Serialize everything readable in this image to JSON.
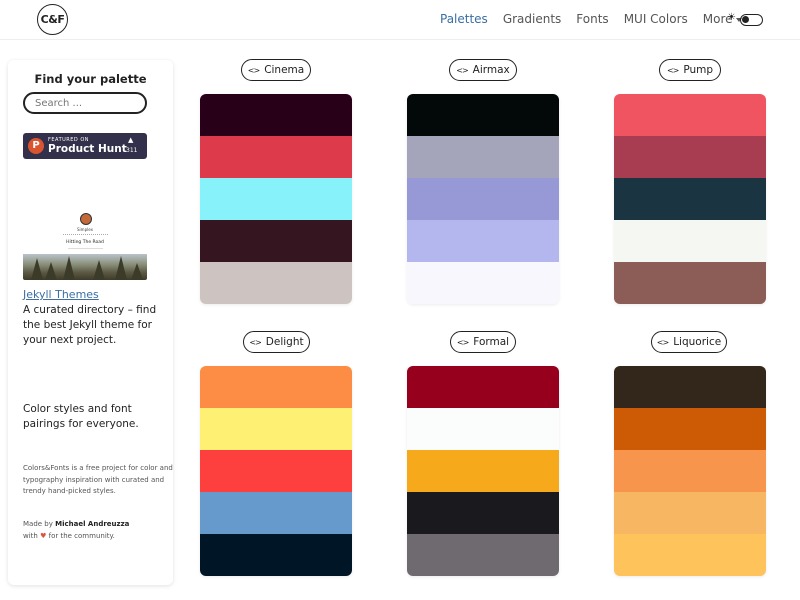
{
  "header": {
    "logo": "C&F",
    "nav": [
      {
        "label": "Palettes",
        "active": true
      },
      {
        "label": "Gradients",
        "active": false
      },
      {
        "label": "Fonts",
        "active": false
      },
      {
        "label": "MUI Colors",
        "active": false
      },
      {
        "label": "More",
        "active": false
      }
    ],
    "theme_icon": "sun-icon"
  },
  "sidebar": {
    "title": "Find your palette",
    "search_placeholder": "Search ...",
    "product_hunt": {
      "small": "FEATURED ON",
      "big": "Product Hunt",
      "count": "311"
    },
    "thumb": {
      "site_name": "Simplex",
      "post_title": "Hitting The Road"
    },
    "jekyll_link": "Jekyll Themes",
    "jekyll_desc": "A curated directory – find the best Jekyll theme for your next project.",
    "tagline": "Color styles and font pairings for everyone.",
    "about": "Colors&Fonts is a free project for color and typography inspiration with curated and trendy hand-picked styles.",
    "made_prefix": "Made by",
    "made_author": "Michael Andreuzza",
    "made_with": "with",
    "made_suffix": "for the community."
  },
  "palettes": [
    {
      "name": "Cinema",
      "colors": [
        "#280119",
        "#dd3b4b",
        "#88f2fa",
        "#341520",
        "#cdc4c1"
      ]
    },
    {
      "name": "Airmax",
      "colors": [
        "#030808",
        "#a4a4ba",
        "#9699d6",
        "#b4b7ee",
        "#f8f7fd"
      ]
    },
    {
      "name": "Pump",
      "colors": [
        "#ef5460",
        "#a83c51",
        "#1b3441",
        "#f4f7f2",
        "#8c5c56"
      ]
    },
    {
      "name": "Delight",
      "colors": [
        "#fd8d45",
        "#fdf073",
        "#fd403d",
        "#6699cc",
        "#001626"
      ]
    },
    {
      "name": "Formal",
      "colors": [
        "#96001c",
        "#fbfdfd",
        "#f5a91b",
        "#1a191e",
        "#6e6a6f"
      ]
    },
    {
      "name": "Liquorice",
      "colors": [
        "#33271b",
        "#cd5b06",
        "#f8954d",
        "#f7b762",
        "#fec35a"
      ]
    }
  ]
}
